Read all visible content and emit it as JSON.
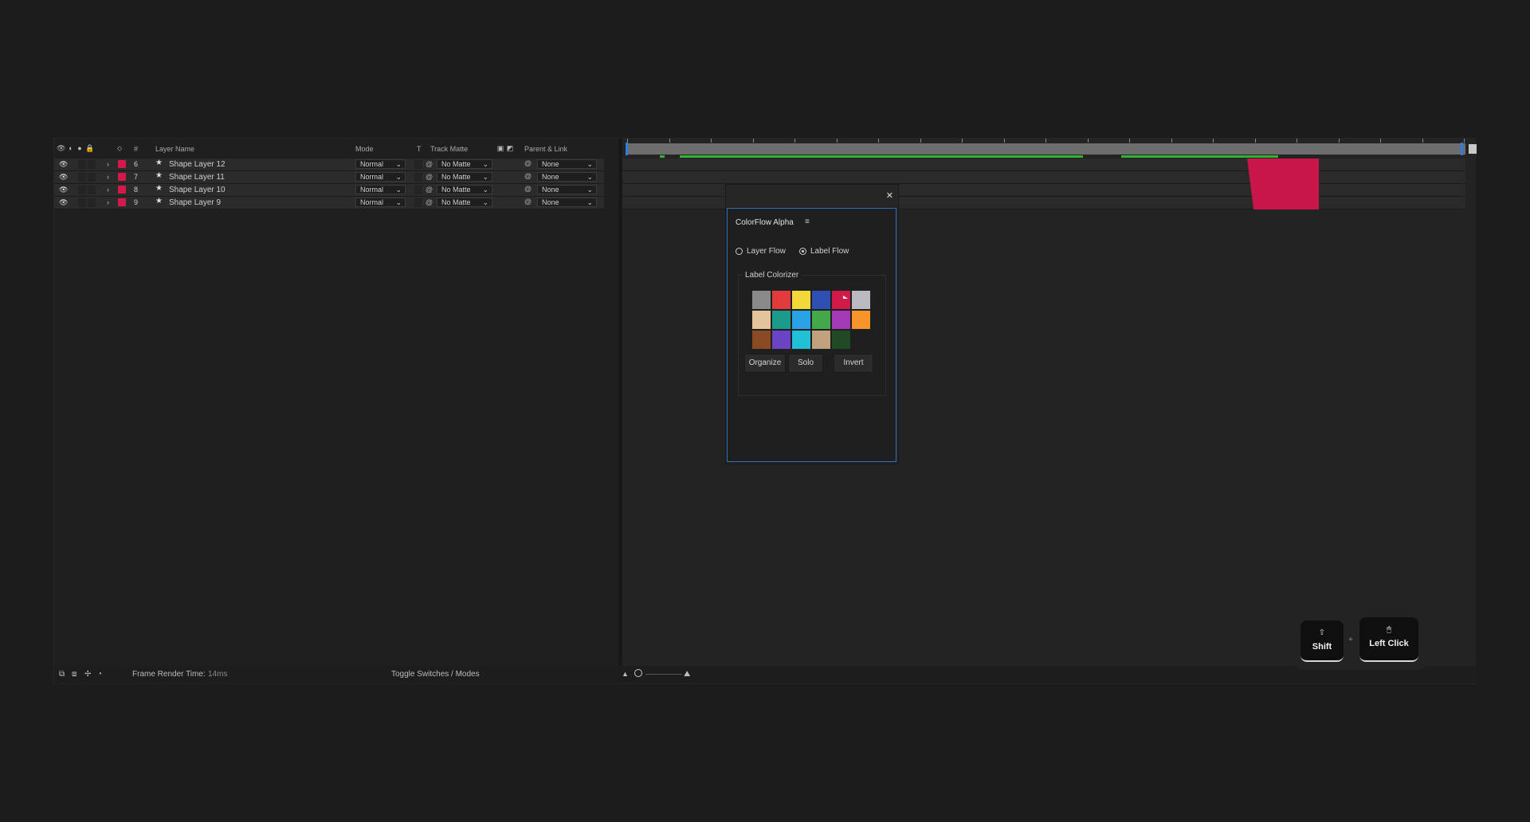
{
  "layer_panel": {
    "headers": {
      "num": "#",
      "layer_name": "Layer Name",
      "mode": "Mode",
      "t": "T",
      "track_matte": "Track Matte",
      "parent": "Parent & Link"
    },
    "layers": [
      {
        "num": "6",
        "name": "Shape Layer 12",
        "mode": "Normal",
        "matte": "No Matte",
        "parent": "None"
      },
      {
        "num": "7",
        "name": "Shape Layer 11",
        "mode": "Normal",
        "matte": "No Matte",
        "parent": "None"
      },
      {
        "num": "8",
        "name": "Shape Layer 10",
        "mode": "Normal",
        "matte": "No Matte",
        "parent": "None"
      },
      {
        "num": "9",
        "name": "Shape Layer 9",
        "mode": "Normal",
        "matte": "No Matte",
        "parent": "None"
      }
    ],
    "label_color": "#d11a4a"
  },
  "bottom_bar": {
    "render_label": "Frame Render Time:",
    "render_value": "14ms",
    "toggle": "Toggle Switches / Modes"
  },
  "plugin": {
    "title": "ColorFlow Alpha",
    "menu_icon": "hamburger-icon",
    "modes": [
      {
        "label": "Layer Flow",
        "selected": false
      },
      {
        "label": "Label Flow",
        "selected": true
      }
    ],
    "group_title": "Label Colorizer",
    "swatches": [
      "#8a8a8a",
      "#e23b3b",
      "#f3d83a",
      "#2f4fb3",
      "#d11a4a",
      "#b9b9c2",
      "#e3c49b",
      "#1a9b8c",
      "#2aa3e6",
      "#42a84a",
      "#a43ab5",
      "#f6962a",
      "#8a4b24",
      "#6a44c2",
      "#22c0d6",
      "#c2a27c",
      "#1f4a23"
    ],
    "buttons": [
      "Organize",
      "Solo",
      "Invert"
    ]
  },
  "keys": {
    "shift": "Shift",
    "left_click": "Left Click"
  }
}
